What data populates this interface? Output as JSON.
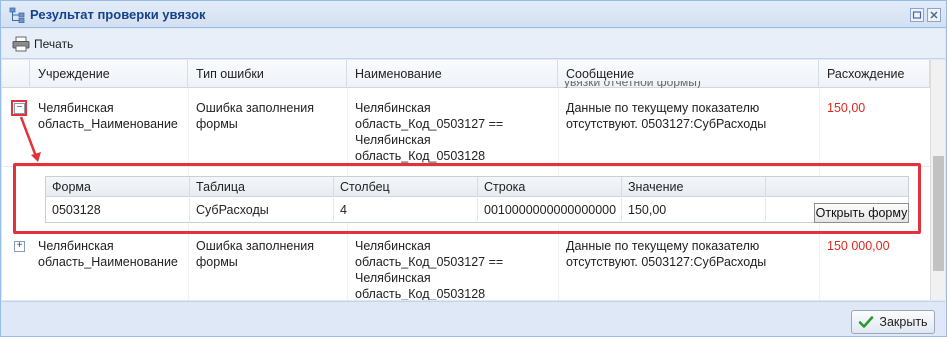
{
  "window": {
    "title": "Результат проверки увязок"
  },
  "toolbar": {
    "print_label": "Печать"
  },
  "columns": [
    "Учреждение",
    "Тип ошибки",
    "Наименование",
    "Сообщение",
    "Расхождение"
  ],
  "header_overflow_text": "увязки отчетной формы)",
  "rows": [
    {
      "institution": [
        "Челябинская",
        "область_Наименование"
      ],
      "error_type": [
        "Ошибка заполнения",
        "формы"
      ],
      "name": [
        "Челябинская",
        "область_Код_0503127 ==",
        "Челябинская",
        "область_Код_0503128"
      ],
      "message": [
        "Данные по текущему показателю",
        "отсутствуют. 0503127:СубРасходы"
      ],
      "difference": "150,00",
      "expander": "−"
    },
    {
      "institution": [
        "Челябинская",
        "область_Наименование"
      ],
      "error_type": [
        "Ошибка заполнения",
        "формы"
      ],
      "name": [
        "Челябинская",
        "область_Код_0503127 ==",
        "Челябинская",
        "область_Код_0503128"
      ],
      "message": [
        "Данные по текущему показателю",
        "отсутствуют. 0503127:СубРасходы"
      ],
      "difference": "150 000,00",
      "expander": "+"
    }
  ],
  "detail": {
    "columns": [
      "Форма",
      "Таблица",
      "Столбец",
      "Строка",
      "Значение"
    ],
    "row": {
      "form": "0503128",
      "table": "СубРасходы",
      "column": "4",
      "line": "0010000000000000000",
      "value": "150,00"
    },
    "open_form_label": "Открыть форму"
  },
  "footer": {
    "close_label": "Закрыть"
  },
  "colors": {
    "highlight": "#e2333c",
    "difference": "#e0281f",
    "title": "#15428b"
  }
}
